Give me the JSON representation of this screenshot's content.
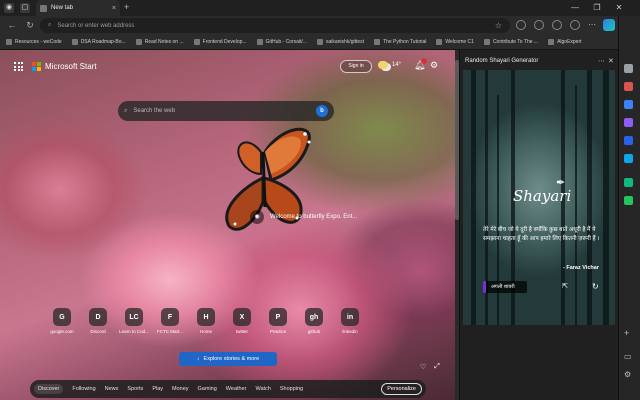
{
  "browser": {
    "tab_title": "New tab",
    "tab_close": "×",
    "new_tab": "+",
    "window_controls": [
      "—",
      "❐",
      "✕"
    ],
    "address_placeholder": "Search or enter web address",
    "back": "←",
    "refresh": "↻",
    "star": "☆"
  },
  "bookmarks": [
    "Resources - weCode",
    "DSA Roadmap-Bo...",
    "Read Notes on ...",
    "Frontend Develop...",
    "GitHub - Corsait/...",
    "saikanishk/gittest",
    "The Python Tutorial",
    "Welcome C1",
    "Contribute To The ...",
    "AlgoExpert"
  ],
  "newtab": {
    "brand": "Microsoft Start",
    "signin": "Sign in",
    "weather_temp": "14°",
    "search_placeholder": "Search the web",
    "bing_label": "b",
    "image_caption": "Welcome to butterfly Expo. Ent...",
    "quicklinks": [
      {
        "label": "google.com",
        "icon": "G"
      },
      {
        "label": "Discord",
        "icon": "D"
      },
      {
        "label": "Learn to Cod...",
        "icon": "LC"
      },
      {
        "label": "FCTC Mart...",
        "icon": "F"
      },
      {
        "label": "Home",
        "icon": "H"
      },
      {
        "label": "twitter",
        "icon": "X"
      },
      {
        "label": "Practice",
        "icon": "P"
      },
      {
        "label": "github",
        "icon": "gh"
      },
      {
        "label": "linkedin",
        "icon": "in"
      }
    ],
    "explore_label": "Explore stories & more",
    "feed_tabs": [
      "Discover",
      "Following",
      "News",
      "Sports",
      "Play",
      "Money",
      "Gaming",
      "Weather",
      "Watch",
      "Shopping"
    ],
    "personalize": "Personalize"
  },
  "sidepanel": {
    "title": "Random Shayari Generator",
    "more": "⋯",
    "close": "✕",
    "logo": "Shayari",
    "text": "तेरे मेरे बीच जो ये दूरी है क्योंकि कुछ बातें अधूरी है मैं ये समझाना चाहता हूँ की आप हमारे लिए कितनी ज़रूरी हैं ।",
    "author": "- Faraz Vichar",
    "next_button": "अगली शायरी"
  },
  "colors": {
    "accent": "#1f66c7",
    "notif_badge": "#d13438",
    "shayari_btn_accent": "#7a2ed6"
  }
}
